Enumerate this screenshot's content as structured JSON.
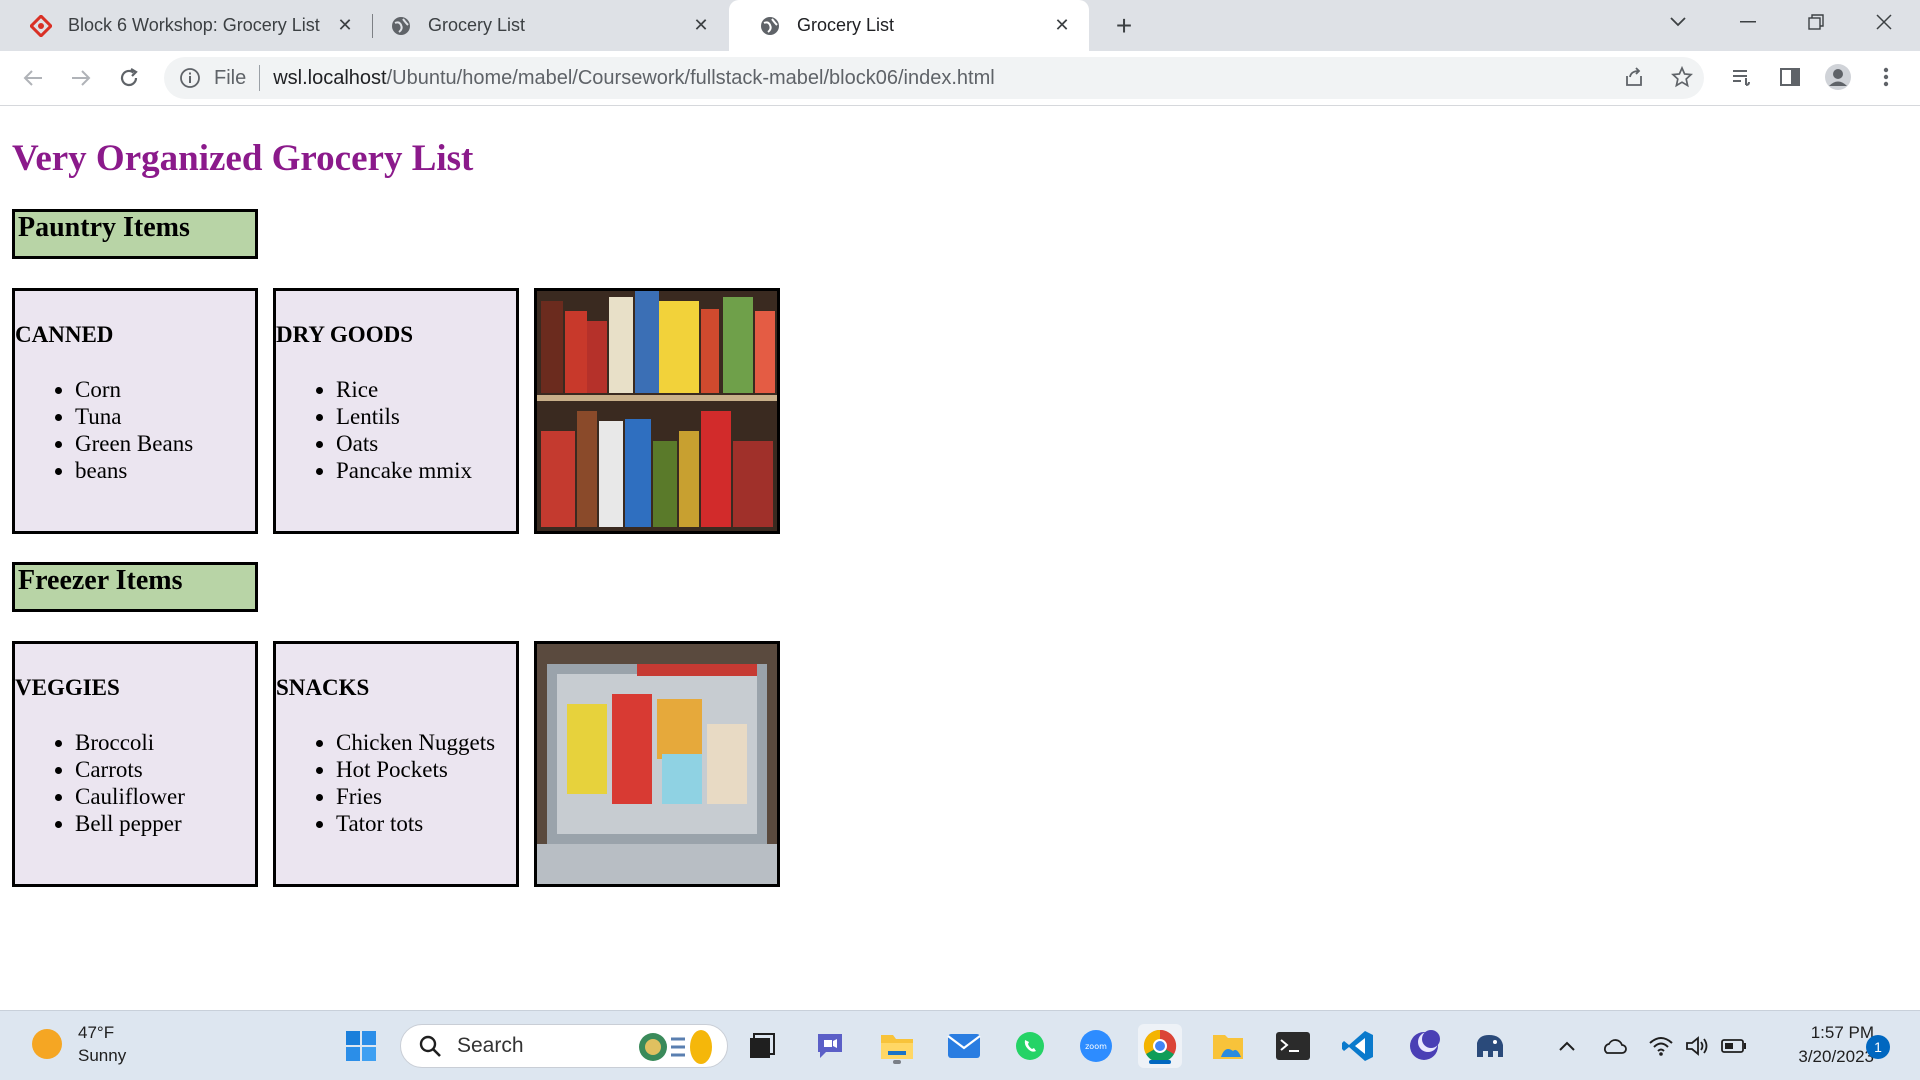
{
  "browser": {
    "tabs": [
      {
        "title": "Block 6 Workshop: Grocery List",
        "icon": "workshop-diamond-icon",
        "active": false
      },
      {
        "title": "Grocery List",
        "icon": "globe-icon",
        "active": false
      },
      {
        "title": "Grocery List",
        "icon": "globe-icon",
        "active": true
      }
    ],
    "new_tab": "+",
    "address": {
      "scheme_label": "File",
      "host": "wsl.localhost",
      "path": "/Ubuntu/home/mabel/Coursework/fullstack-mabel/block06/index.html"
    }
  },
  "page": {
    "title": "Very Organized Grocery List",
    "sections": [
      {
        "header": "Pauntry Items",
        "cards": [
          {
            "heading": "CANNED",
            "items": [
              "Corn",
              "Tuna",
              "Green Beans",
              "beans"
            ]
          },
          {
            "heading": "DRY GOODS",
            "items": [
              "Rice",
              "Lentils",
              "Oats",
              "Pancake mmix"
            ]
          }
        ],
        "photo": "pantry-shelves-photo"
      },
      {
        "header": "Freezer Items",
        "cards": [
          {
            "heading": "VEGGIES",
            "items": [
              "Broccoli",
              "Carrots",
              "Cauliflower",
              "Bell pepper"
            ]
          },
          {
            "heading": "SNACKS",
            "items": [
              "Chicken Nuggets",
              "Hot Pockets",
              "Fries",
              "Tator tots"
            ]
          }
        ],
        "photo": "freezer-drawer-photo"
      }
    ],
    "colors": {
      "title": "#8b1a8b",
      "section_header_bg": "#b8d4a6",
      "card_bg": "#ebe5f0"
    }
  },
  "taskbar": {
    "weather": {
      "temp": "47°F",
      "condition": "Sunny"
    },
    "search_placeholder": "Search",
    "clock": {
      "time": "1:57 PM",
      "date": "3/20/2023"
    },
    "notification_count": "1"
  }
}
